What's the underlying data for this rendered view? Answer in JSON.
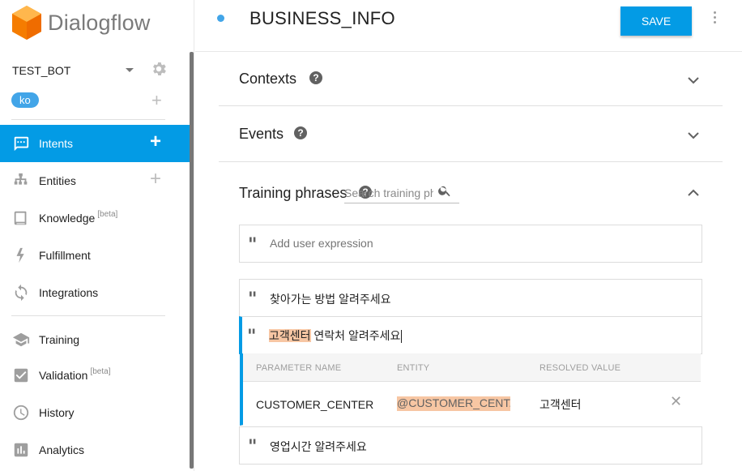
{
  "app": {
    "name": "Dialogflow"
  },
  "agent": {
    "name": "TEST_BOT",
    "language": "ko"
  },
  "sidebar": {
    "items": [
      {
        "label": "Intents",
        "beta": "",
        "icon": "chat-icon",
        "active": true
      },
      {
        "label": "Entities",
        "beta": "",
        "icon": "hierarchy-icon",
        "active": false
      },
      {
        "label": "Knowledge",
        "beta": "[beta]",
        "icon": "book-icon",
        "active": false
      },
      {
        "label": "Fulfillment",
        "beta": "",
        "icon": "bolt-icon",
        "active": false
      },
      {
        "label": "Integrations",
        "beta": "",
        "icon": "sync-icon",
        "active": false
      },
      {
        "label": "Training",
        "beta": "",
        "icon": "graduation-cap-icon",
        "active": false
      },
      {
        "label": "Validation",
        "beta": "[beta]",
        "icon": "checkbox-icon",
        "active": false
      },
      {
        "label": "History",
        "beta": "",
        "icon": "clock-icon",
        "active": false
      },
      {
        "label": "Analytics",
        "beta": "",
        "icon": "bar-chart-icon",
        "active": false
      }
    ]
  },
  "header": {
    "intent_name": "BUSINESS_INFO",
    "save_label": "SAVE"
  },
  "sections": {
    "contexts": "Contexts",
    "events": "Events",
    "training_phrases": "Training phrases",
    "search_placeholder": "Search training phrases"
  },
  "training": {
    "add_placeholder": "Add user expression",
    "phrases": [
      {
        "text": "찾아가는 방법 알려주세요"
      },
      {
        "highlight": "고객센터",
        "rest": " 연락처 알려주세요"
      },
      {
        "text": "영업시간 알려주세요"
      }
    ],
    "param_table": {
      "headers": [
        "PARAMETER NAME",
        "ENTITY",
        "RESOLVED VALUE"
      ],
      "row": {
        "parameter": "CUSTOMER_CENTER",
        "entity": "@CUSTOMER_CENT...",
        "resolved": "고객센터"
      }
    }
  },
  "colors": {
    "accent": "#039be5",
    "highlight": "#f7c6a3",
    "logo_orange": "#ff9800"
  }
}
